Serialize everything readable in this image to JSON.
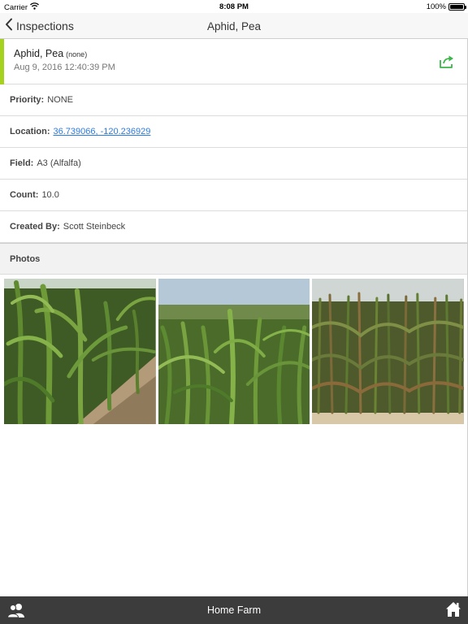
{
  "status_bar": {
    "carrier": "Carrier",
    "time": "8:08 PM",
    "battery": "100%",
    "battery_level": 1.0
  },
  "nav": {
    "back_label": "Inspections",
    "title": "Aphid, Pea"
  },
  "header": {
    "name": "Aphid, Pea",
    "severity": "(none)",
    "date": "Aug 9, 2016 12:40:39 PM",
    "accent_color": "#a4d21f",
    "share_color": "#3cb54a",
    "share_icon": "share-icon"
  },
  "details": {
    "priority": {
      "label": "Priority:",
      "value": "NONE"
    },
    "location": {
      "label": "Location:",
      "value": "36.739066, -120.236929"
    },
    "field": {
      "label": "Field:",
      "value": "A3 (Alfalfa)"
    },
    "count": {
      "label": "Count:",
      "value": "10.0"
    },
    "created_by": {
      "label": "Created By:",
      "value": "Scott Steinbeck"
    }
  },
  "photos": {
    "section_label": "Photos",
    "count": 3
  },
  "tab_bar": {
    "title": "Home Farm",
    "left_icon": "users-icon",
    "right_icon": "home-icon",
    "background": "#3c3c3c"
  }
}
